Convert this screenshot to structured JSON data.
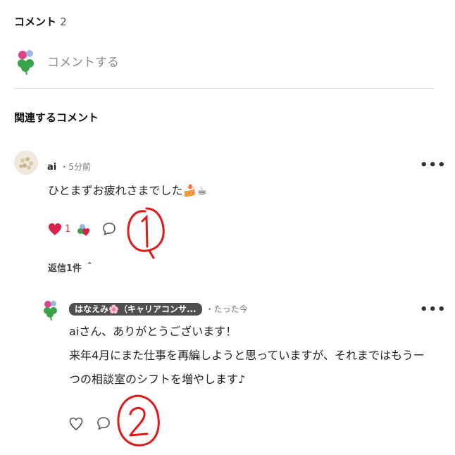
{
  "comments_header": {
    "title": "コメント",
    "count": "2"
  },
  "compose": {
    "placeholder": "コメントする"
  },
  "related": {
    "title": "関連するコメント"
  },
  "comment1": {
    "author": "ai",
    "time": "・5分前",
    "text": "ひとまずお疲れさまでした🍰☕",
    "like_count": "1",
    "more": "•••"
  },
  "replies_toggle": {
    "label": "返信1件 ＾"
  },
  "reply1": {
    "author_badge": "はなえみ🌸（キャリアコンサ...",
    "time": "・たった今",
    "line1": "aiさん、ありがとうございます！",
    "line2": "来年4月にまた仕事を再編しようと思っていますが、それまではもうー",
    "line3": "つの相談室のシフトを増やします♪",
    "more": "•••"
  },
  "annotations": {
    "mark1": "1",
    "mark2": "2"
  },
  "colors": {
    "like": "#d6234a",
    "annotation": "#e01818",
    "clover": "#3aa34a",
    "flower": "#e0408a"
  }
}
